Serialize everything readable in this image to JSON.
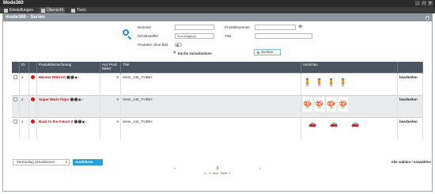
{
  "window": {
    "title": "Mode360"
  },
  "tabs": [
    {
      "label": "Einstellungen"
    },
    {
      "label": "Übersicht"
    },
    {
      "label": "Tools"
    }
  ],
  "page": {
    "title": "mode360 - Serien"
  },
  "search": {
    "nummer_label": "Nummer",
    "produktnummer_label": "Produktnummer",
    "schiebstaffel_label": "Schiebstaffel",
    "schiebstaffel_value": "Kein Abgleich",
    "titel_label": "Titel",
    "produkte_ohne_bild_label": "Produkte ohne Bild",
    "reset_label": "Suche zurücksetzen",
    "search_button": "Suchen"
  },
  "table": {
    "columns": [
      "ID",
      "Produktbezeichnung",
      "Anz Prod Bilder",
      "Titel",
      "Vorschau",
      ""
    ],
    "rows": [
      {
        "id": "3",
        "name": "Meister Röhrich",
        "count": "6",
        "title": "Serie_146_TV3BH",
        "thumb": "🧍",
        "thumb_count": 4,
        "wide": false,
        "edit": "bearbeiten"
      },
      {
        "id": "2",
        "name": "Super Mario Figur",
        "count": "6",
        "title": "Serie_145_TV3BH",
        "thumb": "🍄",
        "thumb_count": 4,
        "wide": false,
        "edit": "bearbeiten"
      },
      {
        "id": "1",
        "name": "Back to the Future 2",
        "count": "6",
        "title": "Serie_144_TV3BH",
        "thumb": "🚗",
        "thumb_count": 3,
        "wide": true,
        "edit": "bearbeiten"
      }
    ]
  },
  "bulk": {
    "select_value": "Vertrauflag aktualisieren",
    "execute_label": "Ausführen",
    "select_all": "Alle wählen / entwählen"
  },
  "pager": {
    "current": "1",
    "summary": "1 - 3 / Anz. Seite: 1",
    "prev": "«",
    "next": "»"
  }
}
